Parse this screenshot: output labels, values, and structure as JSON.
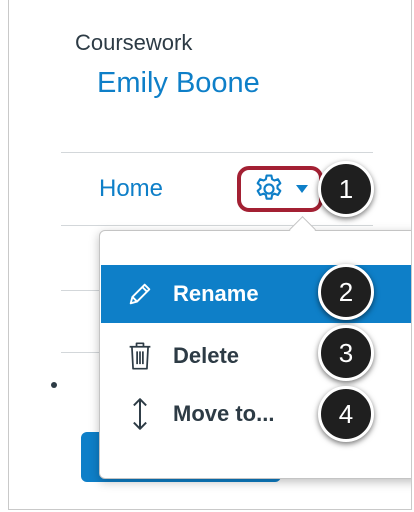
{
  "breadcrumb": {
    "label": "Coursework"
  },
  "user": {
    "name": "Emily Boone"
  },
  "nav": {
    "home_label": "Home"
  },
  "settings": {
    "icon": "gear-icon",
    "toggle_icon": "caret-down-icon"
  },
  "menu": {
    "items": [
      {
        "label": "Rename",
        "icon": "pencil-icon",
        "active": true
      },
      {
        "label": "Delete",
        "icon": "trash-icon",
        "active": false
      },
      {
        "label": "Move to...",
        "icon": "move-vertical-icon",
        "active": false
      }
    ]
  },
  "callouts": [
    "1",
    "2",
    "3",
    "4"
  ],
  "colors": {
    "link": "#0e7fc8",
    "active_bg": "#0e7fc8",
    "highlight_border": "#a32033",
    "callout_bg": "#1f1f1f",
    "text": "#2d3b45"
  }
}
